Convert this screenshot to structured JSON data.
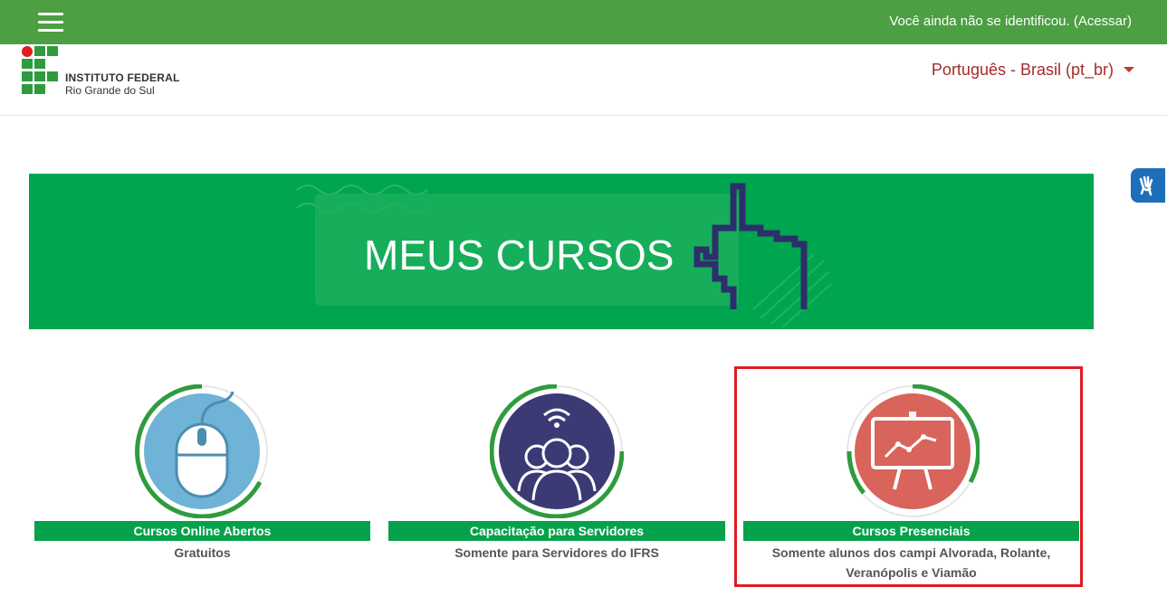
{
  "topbar": {
    "login_text": "Você ainda não se identificou. (Acessar)"
  },
  "header": {
    "logo": {
      "line1": "INSTITUTO FEDERAL",
      "line2": "Rio Grande do Sul"
    },
    "language": "Português - Brasil (pt_br)"
  },
  "banner": {
    "title": "MEUS CURSOS"
  },
  "cards": [
    {
      "title": "Cursos Online Abertos",
      "subtitle": "Gratuitos",
      "icon": "mouse-icon",
      "circle_color": "#6fb3d6"
    },
    {
      "title": "Capacitação para Servidores",
      "subtitle": "Somente para Servidores do IFRS",
      "icon": "people-wifi-icon",
      "circle_color": "#3b3a75"
    },
    {
      "title": "Cursos Presenciais",
      "subtitle_line1": "Somente alunos dos campi Alvorada, Rolante,",
      "subtitle_line2": "Veranópolis e Viamão",
      "icon": "presentation-board-icon",
      "circle_color": "#d8645c"
    }
  ],
  "colors": {
    "topbar": "#4c9f42",
    "banner": "#00a54f",
    "card_title": "#06a24b",
    "language": "#a62b2b",
    "highlight": "#e21b24"
  }
}
